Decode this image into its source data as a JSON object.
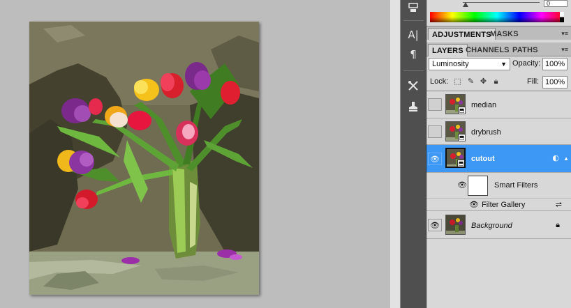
{
  "icons": {
    "type_tool": "character-panel-icon",
    "paragraph": "paragraph-icon",
    "tools": "brush-presets-icon",
    "clone_source": "clone-source-icon",
    "stamp": "stamp-tool-icon"
  },
  "tool_strip": {
    "paragraph_glyph": "¶",
    "type_glyph": "A|"
  },
  "color_panel": {
    "value": "0"
  },
  "adjustments_tabs": [
    {
      "label": "ADJUSTMENTS",
      "active": true
    },
    {
      "label": "MASKS",
      "active": false
    }
  ],
  "layers_tabs": [
    {
      "label": "LAYERS",
      "active": true
    },
    {
      "label": "CHANNELS",
      "active": false
    },
    {
      "label": "PATHS",
      "active": false
    }
  ],
  "layers_controls": {
    "blend_mode": "Luminosity",
    "opacity_label": "Opacity:",
    "opacity_value": "100%",
    "lock_label": "Lock:",
    "fill_label": "Fill:",
    "fill_value": "100%"
  },
  "layers": [
    {
      "name": "median",
      "visible": false,
      "selected": false
    },
    {
      "name": "drybrush",
      "visible": false,
      "selected": false
    },
    {
      "name": "cutout",
      "visible": true,
      "selected": true
    },
    {
      "name": "Background",
      "visible": true,
      "selected": false,
      "locked": true
    }
  ],
  "smart_filters": {
    "label": "Smart Filters",
    "filter_name": "Filter Gallery"
  },
  "colors": {
    "selection": "#3d97f5",
    "canvas_bg": "#bdbdbd",
    "panel_bg": "#d8d8d8",
    "tool_strip_bg": "#4f4f4f"
  }
}
